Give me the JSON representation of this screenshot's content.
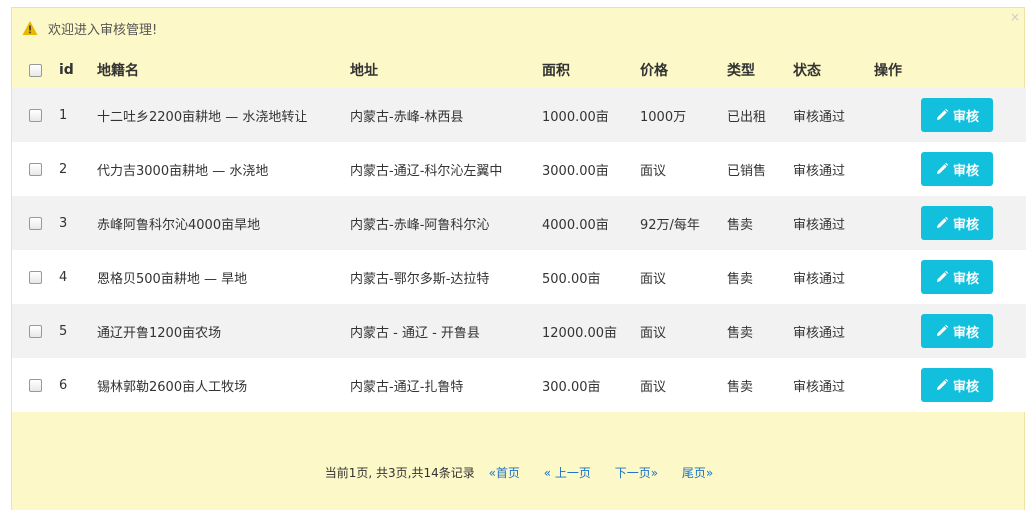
{
  "alert": {
    "text": "欢迎进入审核管理!"
  },
  "columns": [
    "id",
    "地籍名",
    "地址",
    "面积",
    "价格",
    "类型",
    "状态",
    "操作"
  ],
  "rows": [
    {
      "id": "1",
      "name": "十二吐乡2200亩耕地 — 水浇地转让",
      "address": "内蒙古-赤峰-林西县",
      "area": "1000.00亩",
      "price": "1000万",
      "type": "已出租",
      "status": "审核通过",
      "action": "审核"
    },
    {
      "id": "2",
      "name": "代力吉3000亩耕地 — 水浇地",
      "address": "内蒙古-通辽-科尔沁左翼中",
      "area": "3000.00亩",
      "price": "面议",
      "type": "已销售",
      "status": "审核通过",
      "action": "审核"
    },
    {
      "id": "3",
      "name": "赤峰阿鲁科尔沁4000亩旱地",
      "address": "内蒙古-赤峰-阿鲁科尔沁",
      "area": "4000.00亩",
      "price": "92万/每年",
      "type": "售卖",
      "status": "审核通过",
      "action": "审核"
    },
    {
      "id": "4",
      "name": "恩格贝500亩耕地 — 旱地",
      "address": "内蒙古-鄂尔多斯-达拉特",
      "area": "500.00亩",
      "price": "面议",
      "type": "售卖",
      "status": "审核通过",
      "action": "审核"
    },
    {
      "id": "5",
      "name": "通辽开鲁1200亩农场",
      "address": "内蒙古 - 通辽 - 开鲁县",
      "area": "12000.00亩",
      "price": "面议",
      "type": "售卖",
      "status": "审核通过",
      "action": "审核"
    },
    {
      "id": "6",
      "name": "锡林郭勒2600亩人工牧场",
      "address": "内蒙古-通辽-扎鲁特",
      "area": "300.00亩",
      "price": "面议",
      "type": "售卖",
      "status": "审核通过",
      "action": "审核"
    }
  ],
  "pager": {
    "info": "当前1页, 共3页,共14条记录",
    "first": "«首页",
    "prev": "« 上一页",
    "next": "下一页»",
    "last": "尾页»"
  },
  "colors": {
    "panel_bg": "#fcf8c7",
    "button_bg": "#12c0de",
    "link": "#1a73c8"
  }
}
